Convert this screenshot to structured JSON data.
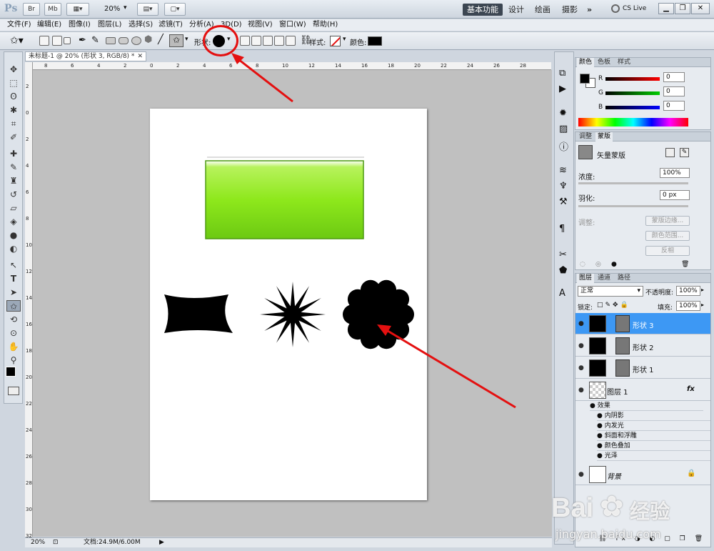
{
  "app": {
    "logo": "Ps",
    "zoom_value": "20%",
    "workspace": {
      "active": "基本功能",
      "tabs": [
        "设计",
        "绘画",
        "摄影"
      ],
      "more": "»"
    },
    "cslive": "CS Live"
  },
  "menu": [
    "文件(F)",
    "编辑(E)",
    "图像(I)",
    "图层(L)",
    "选择(S)",
    "滤镜(T)",
    "分析(A)",
    "3D(D)",
    "视图(V)",
    "窗口(W)",
    "帮助(H)"
  ],
  "options": {
    "shape_label": "形状:",
    "style_label": "样式:",
    "color_label": "颜色:",
    "color_value": "#000000"
  },
  "document": {
    "tab_title": "未标题-1 @ 20% (形状 3, RGB/8) *",
    "ruler_h": [
      "8",
      "6",
      "4",
      "2",
      "0",
      "2",
      "4",
      "6",
      "8",
      "10",
      "12",
      "14",
      "16",
      "18",
      "20",
      "22",
      "24",
      "26",
      "28"
    ],
    "ruler_v": [
      "2",
      "0",
      "2",
      "4",
      "6",
      "8",
      "10",
      "12",
      "14",
      "16",
      "18",
      "20",
      "22",
      "24",
      "26",
      "28",
      "30",
      "32"
    ],
    "status_zoom": "20%",
    "status_doc": "文档:24.9M/6.00M",
    "shapes": {
      "rect_fill": "#8ee81c",
      "shape_fill": "#000000"
    }
  },
  "color_panel": {
    "tabs": [
      "颜色",
      "色板",
      "样式"
    ],
    "channels": [
      {
        "name": "R",
        "value": "0",
        "color": "#d01010"
      },
      {
        "name": "G",
        "value": "0",
        "color": "#10b010"
      },
      {
        "name": "B",
        "value": "0",
        "color": "#1010c0"
      }
    ]
  },
  "adjust_panel": {
    "tabs": [
      "调整",
      "蒙版"
    ],
    "mask_title": "矢量蒙版",
    "density_label": "浓度:",
    "density_value": "100%",
    "feather_label": "羽化:",
    "feather_value": "0 px",
    "adjust_label": "调整:",
    "buttons": [
      "蒙版边缘...",
      "颜色范围...",
      "反相"
    ]
  },
  "layers_panel": {
    "tabs": [
      "图层",
      "通道",
      "路径"
    ],
    "blend_mode": "正常",
    "opacity_label": "不透明度:",
    "opacity_value": "100%",
    "lock_label": "锁定:",
    "fill_label": "填充:",
    "fill_value": "100%",
    "layers": [
      {
        "name": "形状 3",
        "selected": true
      },
      {
        "name": "形状 2",
        "selected": false
      },
      {
        "name": "形状 1",
        "selected": false
      }
    ],
    "layer1": {
      "name": "图层 1",
      "fx": "fx"
    },
    "effects_label": "效果",
    "effects": [
      "内阴影",
      "内发光",
      "斜面和浮雕",
      "颜色叠加",
      "光泽"
    ],
    "background": "背景"
  },
  "watermark": {
    "brand": "Bai",
    "brand2": "经验",
    "url": "jingyan.baidu.com"
  }
}
